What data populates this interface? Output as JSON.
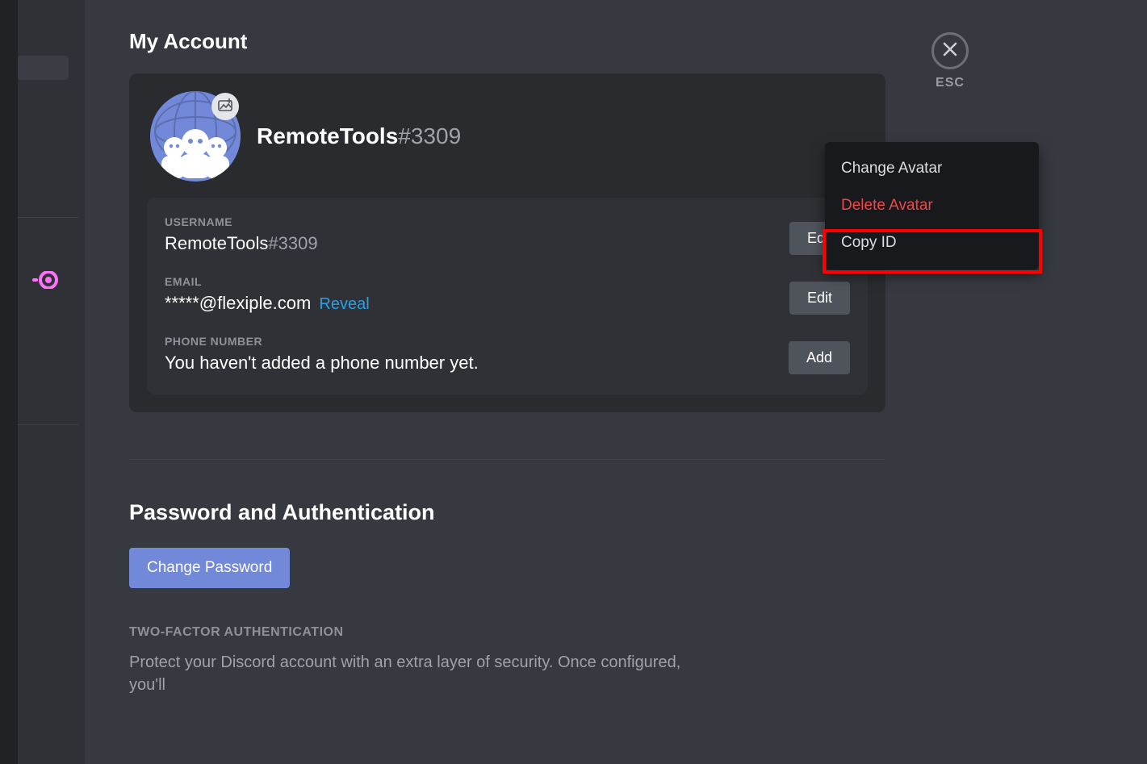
{
  "close": {
    "esc_label": "ESC"
  },
  "page": {
    "title": "My Account",
    "profile": {
      "username": "RemoteTools",
      "discriminator": "#3309"
    },
    "fields": {
      "username": {
        "label": "USERNAME",
        "value_username": "RemoteTools",
        "value_discrim": "#3309",
        "button": "Edit"
      },
      "email": {
        "label": "EMAIL",
        "value": "*****@flexiple.com",
        "reveal": "Reveal",
        "button": "Edit"
      },
      "phone": {
        "label": "PHONE NUMBER",
        "value": "You haven't added a phone number yet.",
        "button": "Add"
      }
    },
    "auth": {
      "title": "Password and Authentication",
      "change_password": "Change Password",
      "twofa_label": "TWO-FACTOR AUTHENTICATION",
      "twofa_desc": "Protect your Discord account with an extra layer of security. Once configured, you'll"
    }
  },
  "context_menu": {
    "change_avatar": "Change Avatar",
    "delete_avatar": "Delete Avatar",
    "copy_id": "Copy ID"
  }
}
